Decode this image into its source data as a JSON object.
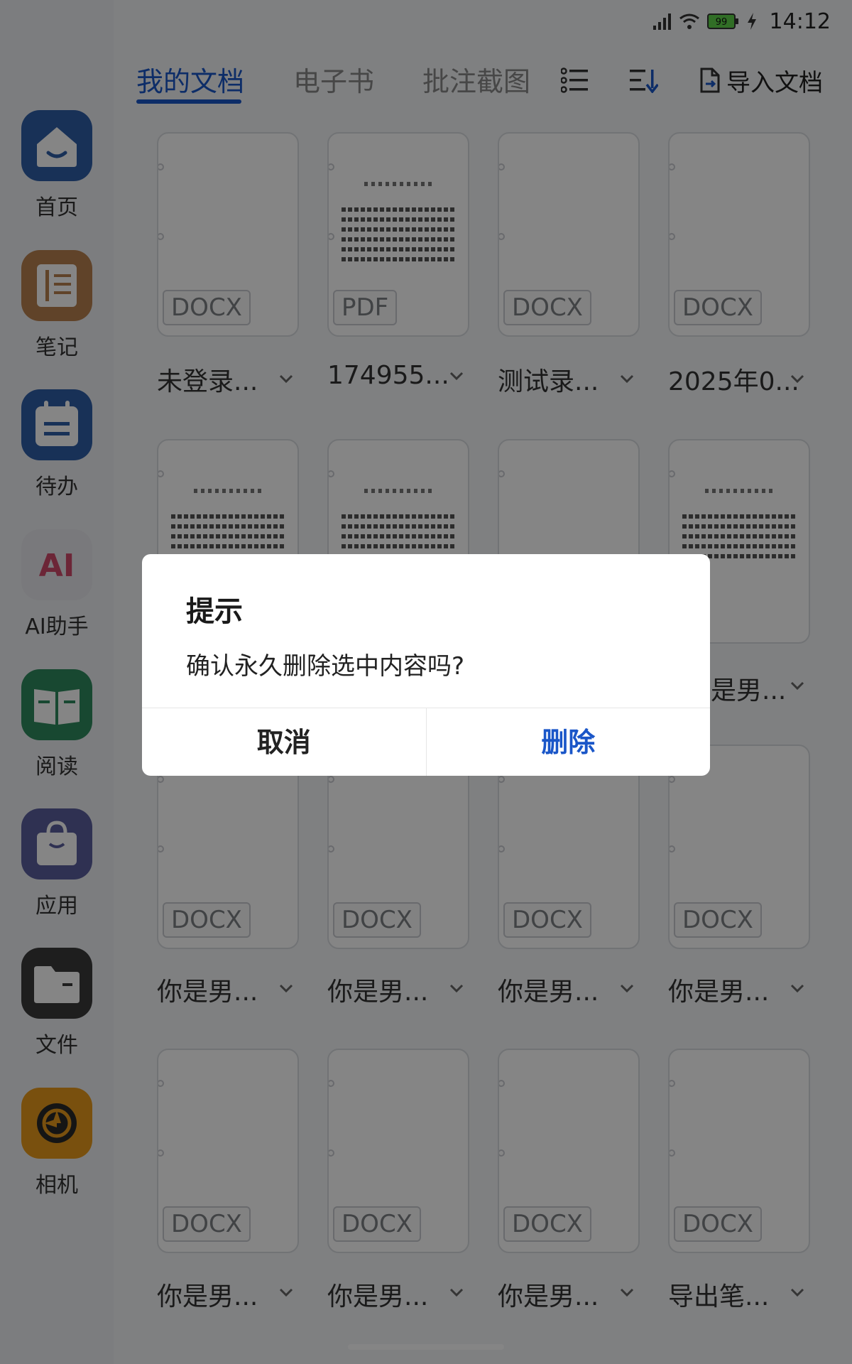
{
  "status": {
    "time": "14:12",
    "battery": "99"
  },
  "sidebar": {
    "items": [
      {
        "label": "首页",
        "icon": "home-icon",
        "color": "#2f5ea8"
      },
      {
        "label": "笔记",
        "icon": "notebook-icon",
        "color": "#b9804f"
      },
      {
        "label": "待办",
        "icon": "todo-icon",
        "color": "#2f5ea8"
      },
      {
        "label": "AI助手",
        "icon": "ai-assistant-icon",
        "color": "#e8e8ee"
      },
      {
        "label": "阅读",
        "icon": "reading-icon",
        "color": "#2f8a5e"
      },
      {
        "label": "应用",
        "icon": "app-bag-icon",
        "color": "#5b5f9e"
      },
      {
        "label": "文件",
        "icon": "folder-icon",
        "color": "#3a3a3a"
      },
      {
        "label": "相机",
        "icon": "camera-icon",
        "color": "#e89a1c"
      }
    ]
  },
  "tabs": [
    {
      "label": "我的文档",
      "active": true
    },
    {
      "label": "电子书",
      "active": false
    },
    {
      "label": "批注截图",
      "active": false
    }
  ],
  "toolbar": {
    "import_label": "导入文档"
  },
  "documents": [
    {
      "name": "未登录...",
      "badge": "DOCX"
    },
    {
      "name": "174955...",
      "badge": "PDF"
    },
    {
      "name": "测试录...",
      "badge": "DOCX"
    },
    {
      "name": "2025年0...",
      "badge": "DOCX"
    },
    {
      "name": "",
      "badge": ""
    },
    {
      "name": "",
      "badge": ""
    },
    {
      "name": "",
      "badge": ""
    },
    {
      "name": "是男...",
      "badge": "F"
    },
    {
      "name": "你是男...",
      "badge": "DOCX"
    },
    {
      "name": "你是男...",
      "badge": "DOCX"
    },
    {
      "name": "你是男...",
      "badge": "DOCX"
    },
    {
      "name": "你是男...",
      "badge": "DOCX"
    },
    {
      "name": "你是男...",
      "badge": "DOCX"
    },
    {
      "name": "你是男...",
      "badge": "DOCX"
    },
    {
      "name": "你是男...",
      "badge": "DOCX"
    },
    {
      "name": "导出笔...",
      "badge": "DOCX"
    }
  ],
  "dialog": {
    "title": "提示",
    "message": "确认永久删除选中内容吗?",
    "cancel_label": "取消",
    "confirm_label": "删除"
  }
}
